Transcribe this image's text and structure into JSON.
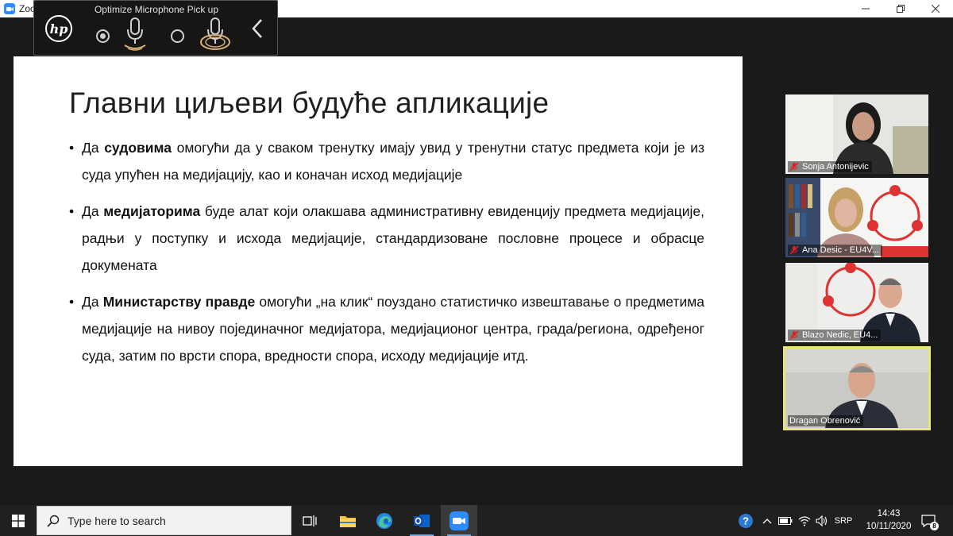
{
  "window": {
    "title": "Zoom",
    "controls": [
      "minimize",
      "maximize",
      "close"
    ]
  },
  "hp_widget": {
    "title": "Optimize Microphone Pick up",
    "logo": "hp",
    "options": [
      {
        "name": "focused-mic",
        "selected": true
      },
      {
        "name": "wide-mic",
        "selected": false
      }
    ]
  },
  "slide": {
    "title": "Главни циљеви будуће апликације",
    "bullets": [
      {
        "pre": "Да ",
        "bold": "судовима",
        "post": " омогући да у сваком тренутку имају увид у тренутни статус предмета који је из суда упућен на медијацију, као и коначан исход медијације"
      },
      {
        "pre": "Да ",
        "bold": "медијаторима",
        "post": " буде алат који олакшава административну евиденцију предмета медијације, радњи у поступку и исхода медијације, стандардизоване пословне процесе и обрасце докумената"
      },
      {
        "pre": "Да ",
        "bold": "Министарству правде",
        "post": " омогући „на клик“ поуздано статистичко извештавање о предметима медијације на нивоу појединачног медијатора, медијационог центра, града/региона, одређеног суда, затим по врсти спора, вредности спора, исходу медијације итд."
      }
    ]
  },
  "participants": [
    {
      "name": "Sonja Antonijevic",
      "muted": true,
      "active": false
    },
    {
      "name": "Ana Desic - EU4V...",
      "muted": true,
      "active": false
    },
    {
      "name": "Blazo Nedic, EU4...",
      "muted": true,
      "active": false
    },
    {
      "name": "Dragan Obrenović",
      "muted": false,
      "active": true
    }
  ],
  "taskbar": {
    "search_placeholder": "Type here to search",
    "apps": [
      "task-view-icon",
      "file-explorer-icon",
      "edge-icon",
      "outlook-icon",
      "zoom-icon"
    ],
    "language": "SRP",
    "time": "14:43",
    "date": "10/11/2020",
    "notification_count": "8"
  },
  "colors": {
    "zoom_blue": "#2D8CFF",
    "active_speaker": "#e6e67a",
    "muted_red": "#e02020"
  }
}
